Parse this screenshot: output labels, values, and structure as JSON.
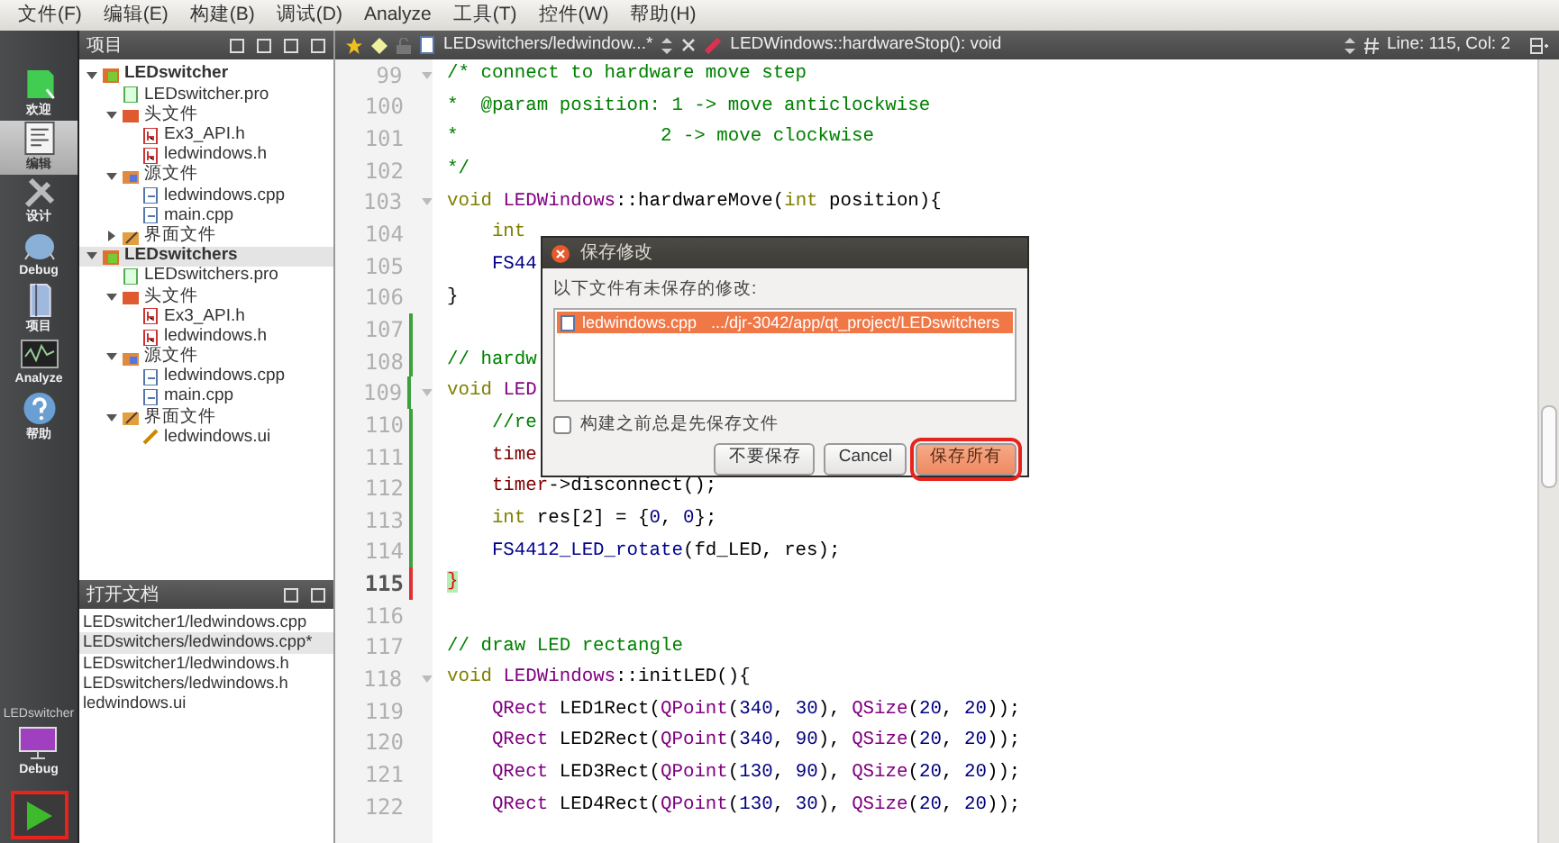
{
  "menu_bar": [
    {
      "label": "文件(F)"
    },
    {
      "label": "编辑(E)"
    },
    {
      "label": "构建(B)"
    },
    {
      "label": "调试(D)"
    },
    {
      "label": "Analyze"
    },
    {
      "label": "工具(T)"
    },
    {
      "label": "控件(W)"
    },
    {
      "label": "帮助(H)"
    }
  ],
  "mode_bar": {
    "modes": [
      {
        "label": "欢迎",
        "kind": "welcome",
        "selected": false
      },
      {
        "label": "编辑",
        "kind": "edit",
        "selected": true
      },
      {
        "label": "设计",
        "kind": "design",
        "selected": false
      },
      {
        "label": "Debug",
        "kind": "debug",
        "selected": false
      },
      {
        "label": "项目",
        "kind": "project",
        "selected": false
      },
      {
        "label": "Analyze",
        "kind": "analyze",
        "selected": false
      },
      {
        "label": "帮助",
        "kind": "help",
        "selected": false
      }
    ],
    "kit": {
      "project": "LEDswitcher",
      "build": "Debug"
    },
    "run_button": {
      "highlighted": true
    }
  },
  "project_panel": {
    "title": "项目",
    "tree": [
      {
        "label": "LEDswitcher",
        "kind": "project",
        "expanded": true,
        "selected": false,
        "children": [
          {
            "label": "LEDswitcher.pro",
            "kind": "pro",
            "selected": false
          },
          {
            "label": "头文件",
            "kind": "headers",
            "expanded": true,
            "selected": false,
            "children": [
              {
                "label": "Ex3_API.h",
                "kind": "h",
                "selected": false
              },
              {
                "label": "ledwindows.h",
                "kind": "h",
                "selected": false
              }
            ]
          },
          {
            "label": "源文件",
            "kind": "sources",
            "expanded": true,
            "selected": false,
            "children": [
              {
                "label": "ledwindows.cpp",
                "kind": "cpp",
                "selected": false
              },
              {
                "label": "main.cpp",
                "kind": "cpp",
                "selected": false
              }
            ]
          },
          {
            "label": "界面文件",
            "kind": "forms",
            "expanded": false,
            "selected": false
          }
        ]
      },
      {
        "label": "LEDswitchers",
        "kind": "project",
        "expanded": true,
        "selected": true,
        "children": [
          {
            "label": "LEDswitchers.pro",
            "kind": "pro",
            "selected": false
          },
          {
            "label": "头文件",
            "kind": "headers",
            "expanded": true,
            "selected": false,
            "children": [
              {
                "label": "Ex3_API.h",
                "kind": "h",
                "selected": false
              },
              {
                "label": "ledwindows.h",
                "kind": "h",
                "selected": false
              }
            ]
          },
          {
            "label": "源文件",
            "kind": "sources",
            "expanded": true,
            "selected": false,
            "children": [
              {
                "label": "ledwindows.cpp",
                "kind": "cpp",
                "selected": false
              },
              {
                "label": "main.cpp",
                "kind": "cpp",
                "selected": false
              }
            ]
          },
          {
            "label": "界面文件",
            "kind": "forms",
            "expanded": true,
            "selected": false,
            "children": [
              {
                "label": "ledwindows.ui",
                "kind": "ui",
                "selected": false
              }
            ]
          }
        ]
      }
    ]
  },
  "open_documents": {
    "title": "打开文档",
    "items": [
      {
        "label": "LEDswitcher1/ledwindows.cpp",
        "selected": false
      },
      {
        "label": "LEDswitchers/ledwindows.cpp*",
        "selected": true
      },
      {
        "label": "LEDswitcher1/ledwindows.h",
        "selected": false
      },
      {
        "label": "LEDswitchers/ledwindows.h",
        "selected": false
      },
      {
        "label": "ledwindows.ui",
        "selected": false
      }
    ]
  },
  "editor": {
    "file_tab": "LEDswitchers/ledwindow...*",
    "function": "LEDWindows::hardwareStop(): void",
    "position": "Line: 115, Col: 2",
    "lines": [
      {
        "number": "99",
        "fold": true,
        "segments": [
          {
            "kind": "comment",
            "text": "/* connect to hardware move step"
          }
        ]
      },
      {
        "number": "100",
        "segments": [
          {
            "kind": "comment",
            "text": "*  @param position: 1 -> move anticlockwise"
          }
        ]
      },
      {
        "number": "101",
        "segments": [
          {
            "kind": "comment",
            "text": "*                  2 -> move clockwise"
          }
        ]
      },
      {
        "number": "102",
        "segments": [
          {
            "kind": "comment",
            "text": "*/"
          }
        ]
      },
      {
        "number": "103",
        "fold": true,
        "segments": [
          {
            "kind": "keyword",
            "text": "void "
          },
          {
            "kind": "type",
            "text": "LEDWindows"
          },
          {
            "kind": "plain",
            "text": "::hardwareMove("
          },
          {
            "kind": "keyword",
            "text": "int"
          },
          {
            "kind": "plain",
            "text": " position){"
          }
        ]
      },
      {
        "number": "104",
        "segments": [
          {
            "kind": "keyword",
            "text": "    int"
          }
        ]
      },
      {
        "number": "105",
        "segments": [
          {
            "kind": "function",
            "text": "    FS44"
          }
        ]
      },
      {
        "number": "106",
        "segments": [
          {
            "kind": "plain",
            "text": "}"
          }
        ]
      },
      {
        "number": "107",
        "color": "#3ca03c"
      },
      {
        "number": "108",
        "color": "#3ca03c",
        "segments": [
          {
            "kind": "comment",
            "text": "// hardw"
          }
        ]
      },
      {
        "number": "109",
        "color": "#3ca03c",
        "fold": true,
        "segments": [
          {
            "kind": "keyword",
            "text": "void "
          },
          {
            "kind": "type",
            "text": "LED"
          }
        ]
      },
      {
        "number": "110",
        "color": "#3ca03c",
        "segments": [
          {
            "kind": "comment",
            "text": "    //re"
          }
        ]
      },
      {
        "number": "111",
        "color": "#3ca03c",
        "segments": [
          {
            "kind": "member",
            "text": "    time"
          }
        ]
      },
      {
        "number": "112",
        "color": "#3ca03c",
        "segments": [
          {
            "kind": "member",
            "text": "    timer"
          },
          {
            "kind": "plain",
            "text": "->disconnect();"
          }
        ]
      },
      {
        "number": "113",
        "color": "#3ca03c",
        "segments": [
          {
            "kind": "keyword",
            "text": "    int"
          },
          {
            "kind": "plain",
            "text": " res[2] = {"
          },
          {
            "kind": "number",
            "text": "0"
          },
          {
            "kind": "plain",
            "text": ", "
          },
          {
            "kind": "number",
            "text": "0"
          },
          {
            "kind": "plain",
            "text": "};"
          }
        ]
      },
      {
        "number": "114",
        "color": "#3ca03c",
        "segments": [
          {
            "kind": "function",
            "text": "    FS4412_LED_rotate"
          },
          {
            "kind": "plain",
            "text": "(fd_LED, res);"
          }
        ]
      },
      {
        "number": "115",
        "color": "#e03030",
        "current": true,
        "segments": [
          {
            "kind": "brace_match",
            "text": "}"
          }
        ]
      },
      {
        "number": "116"
      },
      {
        "number": "117",
        "segments": [
          {
            "kind": "comment",
            "text": "// draw LED rectangle"
          }
        ]
      },
      {
        "number": "118",
        "fold": true,
        "segments": [
          {
            "kind": "keyword",
            "text": "void "
          },
          {
            "kind": "type",
            "text": "LEDWindows"
          },
          {
            "kind": "plain",
            "text": "::initLED(){"
          }
        ]
      },
      {
        "number": "119",
        "segments": [
          {
            "kind": "type",
            "text": "    QRect"
          },
          {
            "kind": "plain",
            "text": " LED1Rect("
          },
          {
            "kind": "type",
            "text": "QPoint"
          },
          {
            "kind": "plain",
            "text": "("
          },
          {
            "kind": "number",
            "text": "340"
          },
          {
            "kind": "plain",
            "text": ", "
          },
          {
            "kind": "number",
            "text": "30"
          },
          {
            "kind": "plain",
            "text": "), "
          },
          {
            "kind": "type",
            "text": "QSize"
          },
          {
            "kind": "plain",
            "text": "("
          },
          {
            "kind": "number",
            "text": "20"
          },
          {
            "kind": "plain",
            "text": ", "
          },
          {
            "kind": "number",
            "text": "20"
          },
          {
            "kind": "plain",
            "text": "));"
          }
        ]
      },
      {
        "number": "120",
        "segments": [
          {
            "kind": "type",
            "text": "    QRect"
          },
          {
            "kind": "plain",
            "text": " LED2Rect("
          },
          {
            "kind": "type",
            "text": "QPoint"
          },
          {
            "kind": "plain",
            "text": "("
          },
          {
            "kind": "number",
            "text": "340"
          },
          {
            "kind": "plain",
            "text": ", "
          },
          {
            "kind": "number",
            "text": "90"
          },
          {
            "kind": "plain",
            "text": "), "
          },
          {
            "kind": "type",
            "text": "QSize"
          },
          {
            "kind": "plain",
            "text": "("
          },
          {
            "kind": "number",
            "text": "20"
          },
          {
            "kind": "plain",
            "text": ", "
          },
          {
            "kind": "number",
            "text": "20"
          },
          {
            "kind": "plain",
            "text": "));"
          }
        ]
      },
      {
        "number": "121",
        "segments": [
          {
            "kind": "type",
            "text": "    QRect"
          },
          {
            "kind": "plain",
            "text": " LED3Rect("
          },
          {
            "kind": "type",
            "text": "QPoint"
          },
          {
            "kind": "plain",
            "text": "("
          },
          {
            "kind": "number",
            "text": "130"
          },
          {
            "kind": "plain",
            "text": ", "
          },
          {
            "kind": "number",
            "text": "90"
          },
          {
            "kind": "plain",
            "text": "), "
          },
          {
            "kind": "type",
            "text": "QSize"
          },
          {
            "kind": "plain",
            "text": "("
          },
          {
            "kind": "number",
            "text": "20"
          },
          {
            "kind": "plain",
            "text": ", "
          },
          {
            "kind": "number",
            "text": "20"
          },
          {
            "kind": "plain",
            "text": "));"
          }
        ]
      },
      {
        "number": "122",
        "segments": [
          {
            "kind": "type",
            "text": "    QRect"
          },
          {
            "kind": "plain",
            "text": " LED4Rect("
          },
          {
            "kind": "type",
            "text": "QPoint"
          },
          {
            "kind": "plain",
            "text": "("
          },
          {
            "kind": "number",
            "text": "130"
          },
          {
            "kind": "plain",
            "text": ", "
          },
          {
            "kind": "number",
            "text": "30"
          },
          {
            "kind": "plain",
            "text": "), "
          },
          {
            "kind": "type",
            "text": "QSize"
          },
          {
            "kind": "plain",
            "text": "("
          },
          {
            "kind": "number",
            "text": "20"
          },
          {
            "kind": "plain",
            "text": ", "
          },
          {
            "kind": "number",
            "text": "20"
          },
          {
            "kind": "plain",
            "text": "));"
          }
        ]
      }
    ]
  },
  "dialog": {
    "title": "保存修改",
    "message": "以下文件有未保存的修改:",
    "files": [
      {
        "name": "ledwindows.cpp",
        "path": ".../djr-3042/app/qt_project/LEDswitchers",
        "selected": true
      }
    ],
    "checkbox": {
      "label": "构建之前总是先保存文件",
      "checked": false
    },
    "buttons": [
      {
        "label": "不要保存",
        "default": false,
        "highlighted": false
      },
      {
        "label": "Cancel",
        "default": false,
        "highlighted": false
      },
      {
        "label": "保存所有",
        "default": true,
        "highlighted": true
      }
    ]
  }
}
